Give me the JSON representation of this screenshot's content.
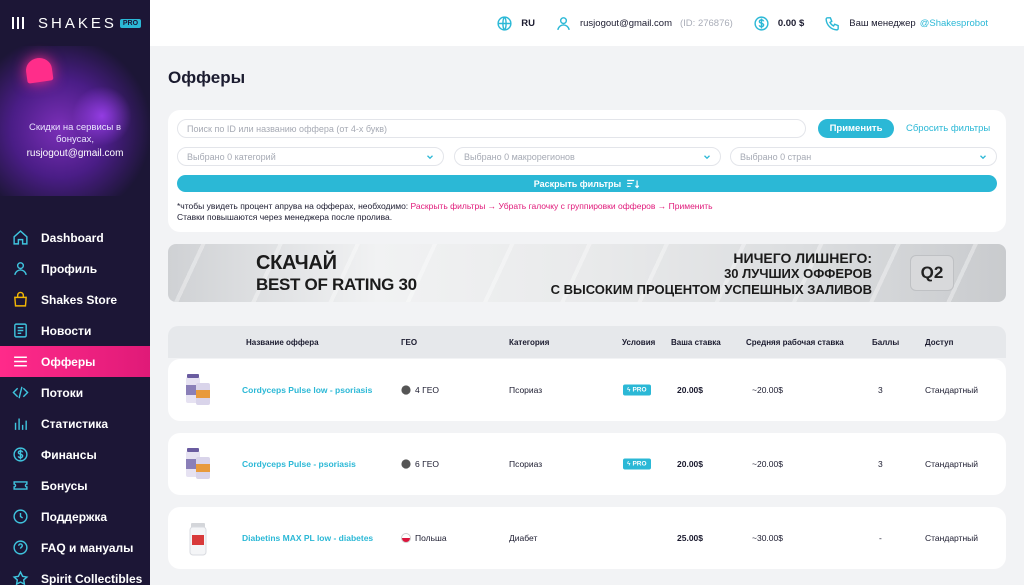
{
  "app": {
    "logo_text": "SHAKES",
    "logo_badge": "PRO"
  },
  "promo": {
    "line1": "Скидки на сервисы в",
    "line2": "бонусах,",
    "email": "rusjogout@gmail.com"
  },
  "nav": {
    "items": [
      {
        "label": "Dashboard",
        "icon": "home-icon"
      },
      {
        "label": "Профиль",
        "icon": "user-icon"
      },
      {
        "label": "Shakes Store",
        "icon": "store-icon"
      },
      {
        "label": "Новости",
        "icon": "news-icon"
      },
      {
        "label": "Офферы",
        "icon": "offers-icon",
        "active": true
      },
      {
        "label": "Потоки",
        "icon": "code-icon"
      },
      {
        "label": "Статистика",
        "icon": "stats-icon"
      },
      {
        "label": "Финансы",
        "icon": "dollar-icon"
      },
      {
        "label": "Бонусы",
        "icon": "ticket-icon"
      },
      {
        "label": "Поддержка",
        "icon": "support-icon"
      },
      {
        "label": "FAQ и мануалы",
        "icon": "faq-icon"
      },
      {
        "label": "Spirit Collectibles",
        "icon": "collectibles-icon"
      }
    ]
  },
  "header": {
    "language": "RU",
    "email": "rusjogout@gmail.com",
    "user_id": "(ID: 276876)",
    "balance": "0.00 $",
    "manager_label": "Ваш менеджер",
    "manager_handle": "@Shakesprobot"
  },
  "page": {
    "title": "Офферы"
  },
  "filters": {
    "search_placeholder": "Поиск по ID или названию оффера (от 4-х букв)",
    "apply_label": "Применить",
    "reset_label": "Сбросить фильтры",
    "categories_placeholder": "Выбрано 0 категорий",
    "macroregions_placeholder": "Выбрано 0 макрорегионов",
    "countries_placeholder": "Выбрано 0 стран",
    "expand_label": "Раскрыть фильтры",
    "note_prefix": "*чтобы увидеть процент апрува на офферах, необходимо: ",
    "note_steps": "Раскрыть фильтры → Убрать галочку с группировки офферов → Применить",
    "note_line2": "Ставки повышаются через менеджера после пролива."
  },
  "banner": {
    "left_line1": "СКАЧАЙ",
    "left_line2": "BEST OF RATING 30",
    "right_line1": "НИЧЕГО ЛИШНЕГО:",
    "right_line2": "30 ЛУЧШИХ ОФФЕРОВ",
    "right_line3": "С ВЫСОКИМ ПРОЦЕНТОМ УСПЕШНЫХ ЗАЛИВОВ",
    "badge": "Q2"
  },
  "table": {
    "headers": {
      "name": "Название оффера",
      "geo": "ГЕО",
      "category": "Категория",
      "conditions": "Условия",
      "your_rate": "Ваша ставка",
      "avg_rate": "Средняя рабочая ставка",
      "points": "Баллы",
      "access": "Доступ"
    },
    "rows": [
      {
        "name": "Cordyceps Pulse low - psoriasis",
        "geo": "4 ГЕО",
        "category": "Псориаз",
        "condition_badge": "PRO",
        "rate": "20.00$",
        "avg_rate": "~20.00$",
        "points": "3",
        "access": "Стандартный"
      },
      {
        "name": "Cordyceps Pulse - psoriasis",
        "geo": "6 ГЕО",
        "category": "Псориаз",
        "condition_badge": "PRO",
        "rate": "20.00$",
        "avg_rate": "~20.00$",
        "points": "3",
        "access": "Стандартный"
      },
      {
        "name": "Diabetins MAX PL low - diabetes",
        "geo": "Польша",
        "category": "Диабет",
        "condition_badge": "",
        "rate": "25.00$",
        "avg_rate": "~30.00$",
        "points": "-",
        "access": "Стандартный"
      }
    ]
  },
  "colors": {
    "accent": "#2bb8d6",
    "active": "#e01a78",
    "sidebar_bg": "#1c1636"
  }
}
